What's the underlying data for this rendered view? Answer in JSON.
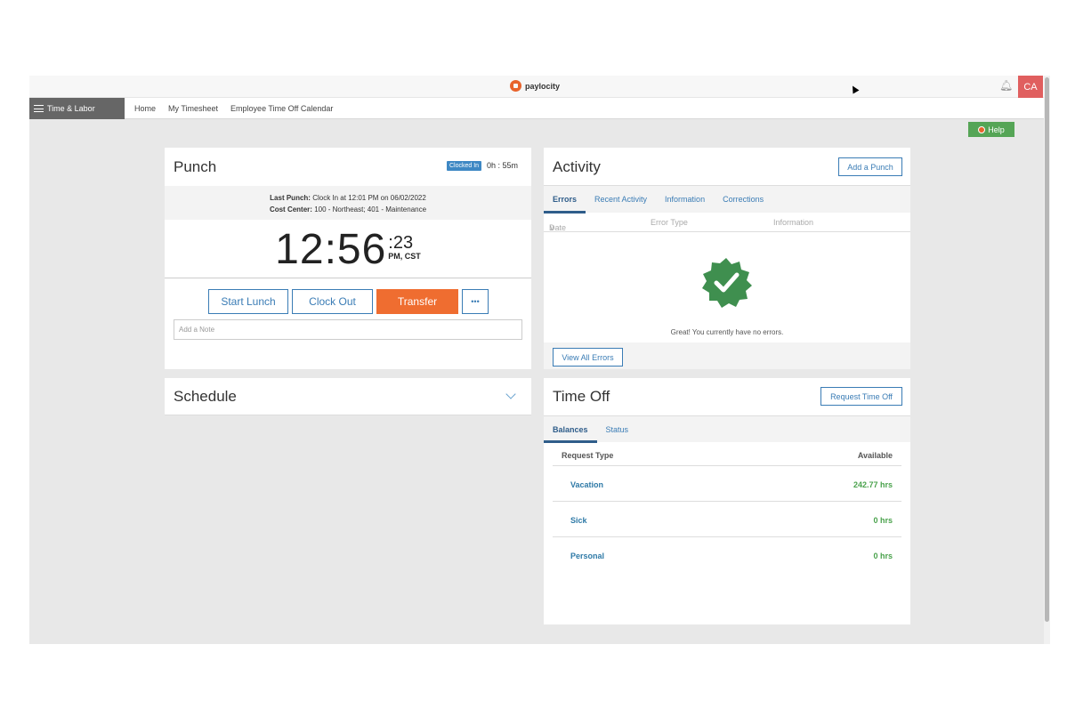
{
  "brand": {
    "name": "paylocity",
    "accent": "#ef6d30",
    "link": "#3a7cb5"
  },
  "topbar": {
    "avatar_initials": "CA",
    "bell_icon": "bell-icon"
  },
  "nav": {
    "module": "Time & Labor",
    "links": [
      "Home",
      "My Timesheet",
      "Employee Time Off Calendar"
    ]
  },
  "help": {
    "label": "Help"
  },
  "punch": {
    "title": "Punch",
    "status_badge": "Clocked In",
    "duration": "0h : 55m",
    "last_punch_label": "Last Punch:",
    "last_punch_value": "Clock In at 12:01 PM on 06/02/2022",
    "cost_center_label": "Cost Center:",
    "cost_center_value": "100 - Northeast; 401 - Maintenance",
    "time_hm": "12:56",
    "time_sec": ":23",
    "time_tz": "PM, CST",
    "buttons": {
      "start_lunch": "Start Lunch",
      "clock_out": "Clock Out",
      "transfer": "Transfer",
      "more": "•••"
    },
    "note_placeholder": "Add a Note"
  },
  "schedule": {
    "title": "Schedule"
  },
  "activity": {
    "title": "Activity",
    "add_punch": "Add a Punch",
    "tabs": [
      "Errors",
      "Recent Activity",
      "Information",
      "Corrections"
    ],
    "columns": [
      "Date",
      "Error Type",
      "Information"
    ],
    "empty_message": "Great! You currently have no errors.",
    "view_all": "View All Errors"
  },
  "timeoff": {
    "title": "Time Off",
    "request_button": "Request Time Off",
    "tabs": [
      "Balances",
      "Status"
    ],
    "header": {
      "type": "Request Type",
      "available": "Available"
    },
    "rows": [
      {
        "type": "Vacation",
        "available": "242.77 hrs"
      },
      {
        "type": "Sick",
        "available": "0 hrs"
      },
      {
        "type": "Personal",
        "available": "0 hrs"
      }
    ]
  }
}
